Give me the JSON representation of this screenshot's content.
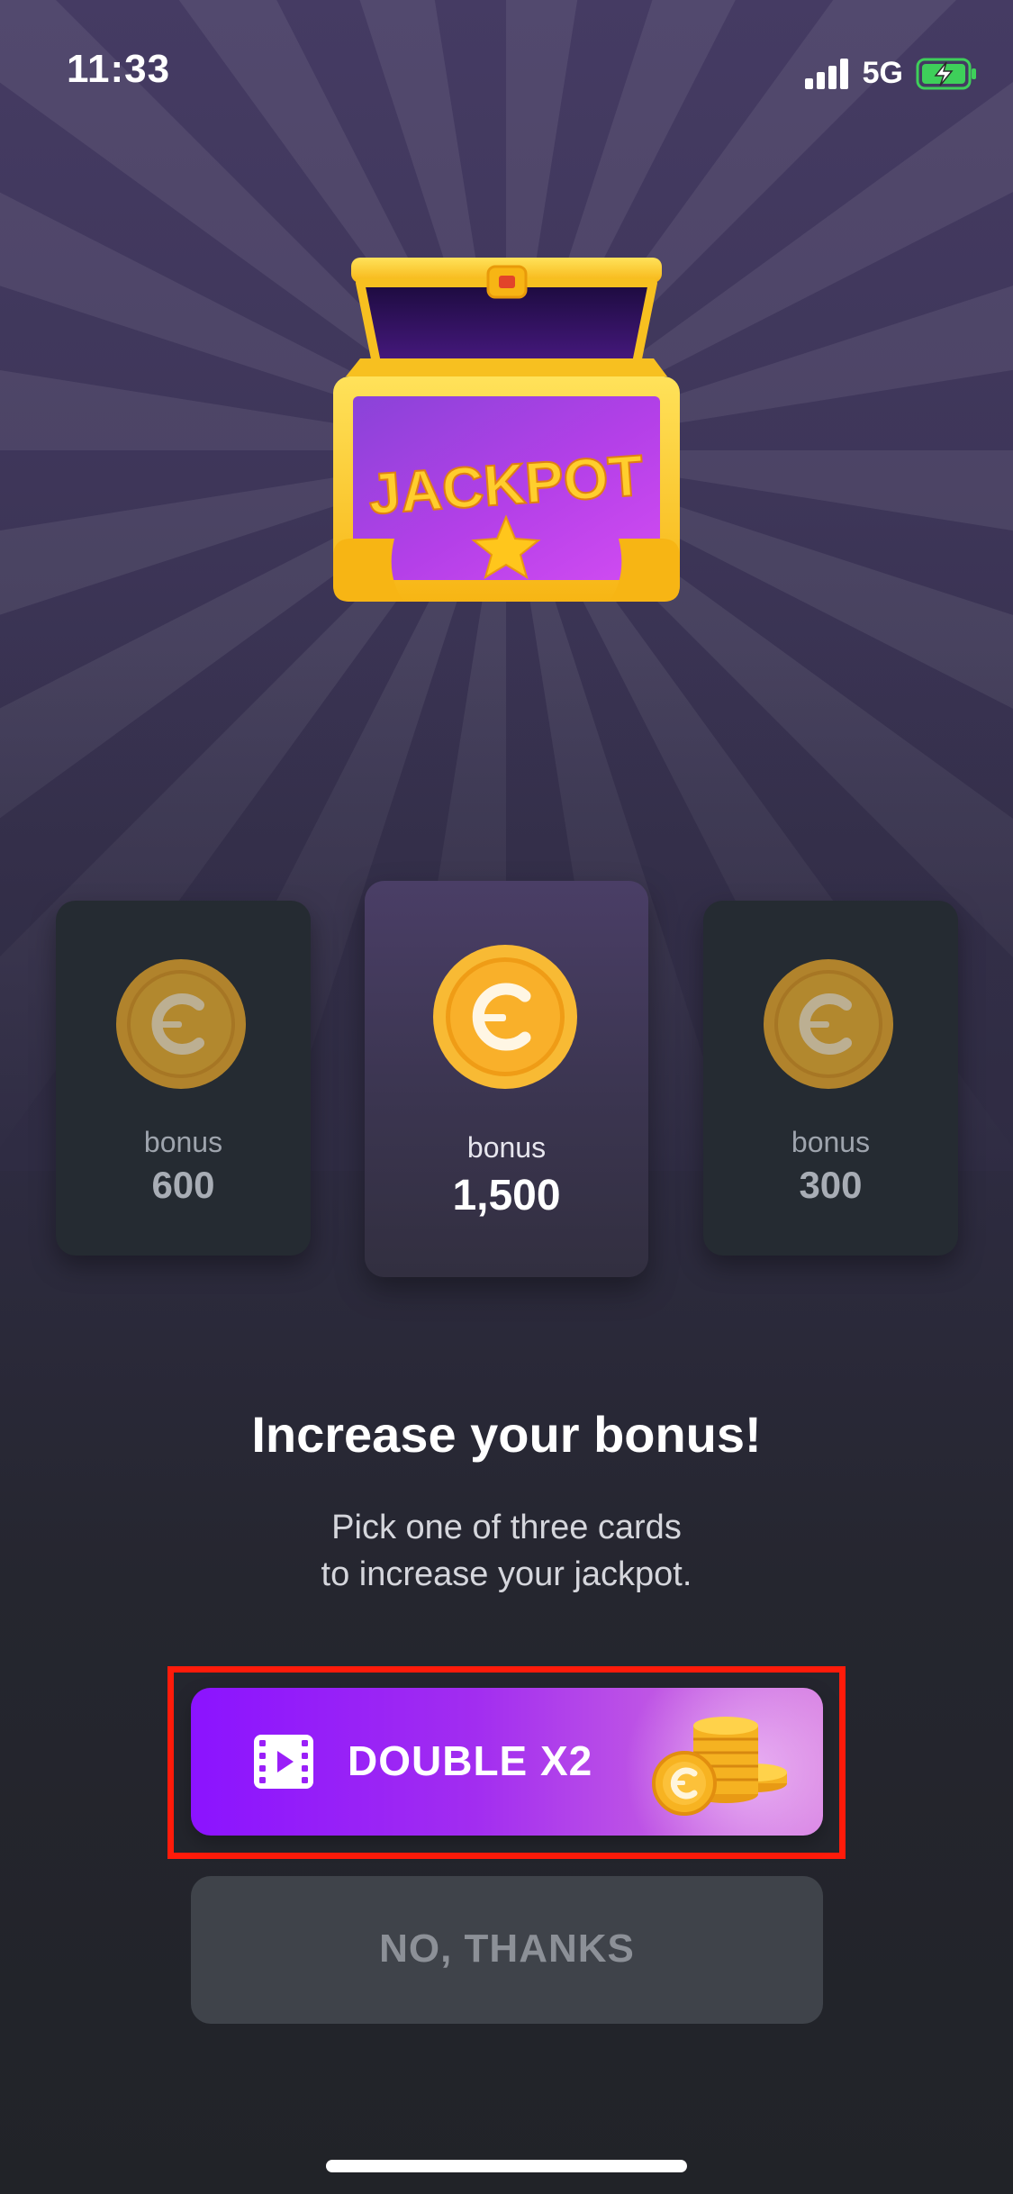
{
  "status_bar": {
    "time": "11:33",
    "network": "5G"
  },
  "chest": {
    "label": "JACKPOT"
  },
  "cards": [
    {
      "label": "bonus",
      "value": "600"
    },
    {
      "label": "bonus",
      "value": "1,500"
    },
    {
      "label": "bonus",
      "value": "300"
    }
  ],
  "headline": "Increase your bonus!",
  "subtitle_line1": "Pick one of three cards",
  "subtitle_line2": "to increase your jackpot.",
  "buttons": {
    "double_label": "DOUBLE X2",
    "no_thanks_label": "NO, THANKS"
  },
  "colors": {
    "highlight_border": "#ff1b0a",
    "double_button_start": "#8b13ff",
    "double_button_end": "#d67ee2",
    "secondary_button": "#3f434a",
    "coin_gold": "#f3a81c"
  }
}
